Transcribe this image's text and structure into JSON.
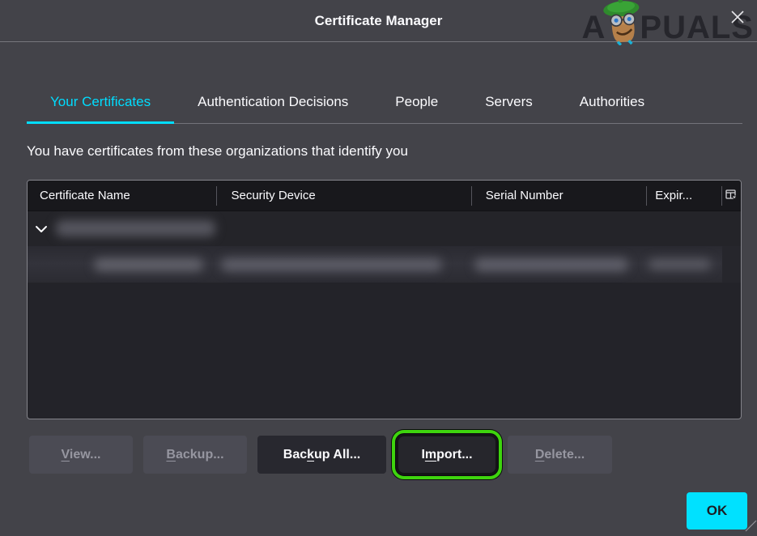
{
  "window": {
    "title": "Certificate Manager"
  },
  "watermark": {
    "left": "A",
    "right": "PUALS"
  },
  "tabs": {
    "items": [
      {
        "id": "your-certificates",
        "label": "Your Certificates",
        "active": true
      },
      {
        "id": "authentication-decisions",
        "label": "Authentication Decisions",
        "active": false
      },
      {
        "id": "people",
        "label": "People",
        "active": false
      },
      {
        "id": "servers",
        "label": "Servers",
        "active": false
      },
      {
        "id": "authorities",
        "label": "Authorities",
        "active": false
      }
    ]
  },
  "description": "You have certificates from these organizations that identify you",
  "table": {
    "columns": [
      {
        "id": "certificate-name",
        "label": "Certificate Name"
      },
      {
        "id": "security-device",
        "label": "Security Device"
      },
      {
        "id": "serial-number",
        "label": "Serial Number"
      },
      {
        "id": "expires-on",
        "label": "Expir..."
      },
      {
        "id": "column-picker",
        "label": ""
      }
    ],
    "rows": [
      {
        "type": "group",
        "expanded": true,
        "redacted": true
      },
      {
        "type": "certificate",
        "selected": true,
        "redacted": true
      }
    ]
  },
  "buttons": {
    "view": {
      "label": "View...",
      "underline_index": 0,
      "enabled": false
    },
    "backup": {
      "label": "Backup...",
      "underline_index": 0,
      "enabled": false
    },
    "backup_all": {
      "label": "Backup All...",
      "underline_index": 3,
      "enabled": true
    },
    "import": {
      "label": "Import...",
      "underline_index": 1,
      "enabled": true,
      "highlighted": true
    },
    "delete": {
      "label": "Delete...",
      "underline_index": 0,
      "enabled": false
    }
  },
  "ok_button": {
    "label": "OK"
  },
  "colors": {
    "accent_cyan": "#00ddff",
    "highlight_green": "#3ed40e",
    "window_bg": "#434349",
    "table_bg": "#232329",
    "header_bg": "#18181c"
  }
}
